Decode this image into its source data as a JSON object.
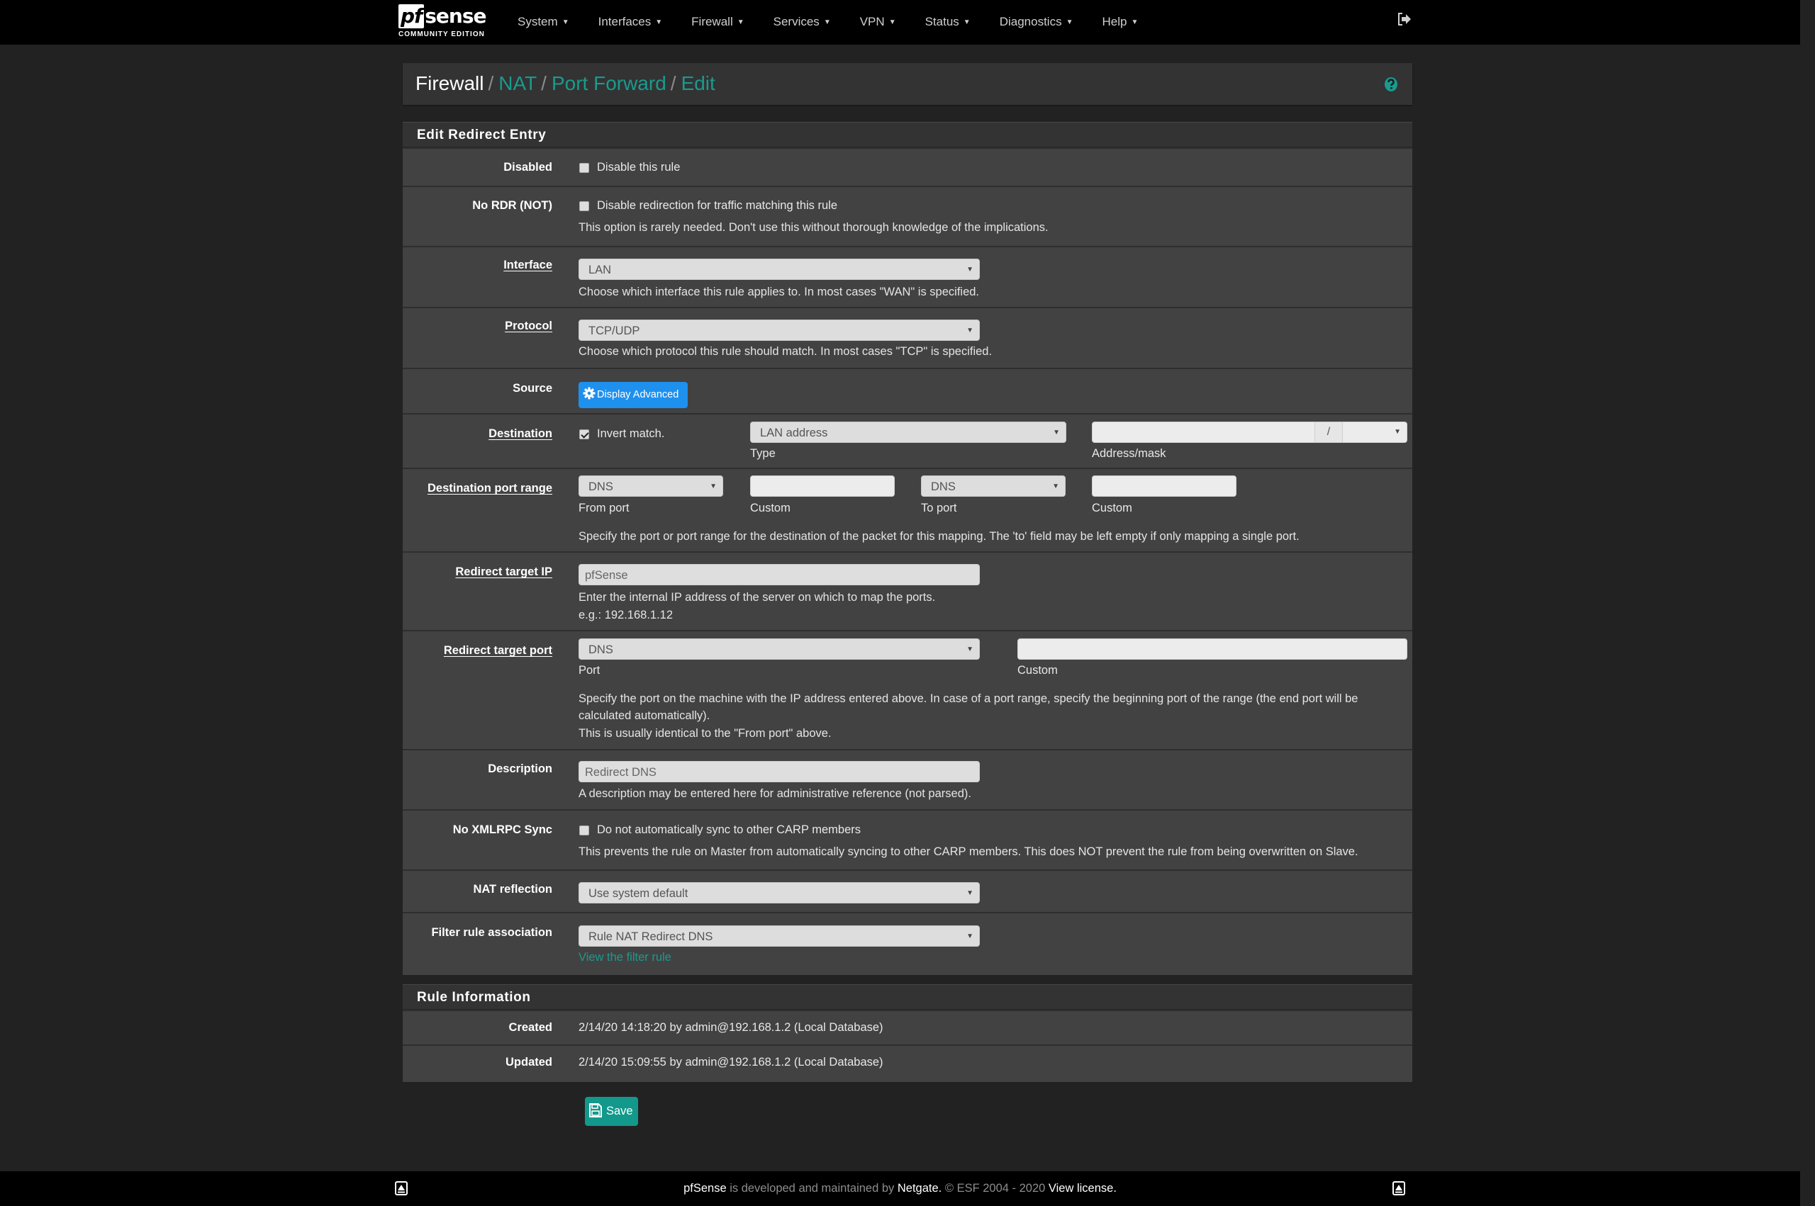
{
  "brand": {
    "logo_text_pf": "pf",
    "logo_text_sense": "sense",
    "edition": "COMMUNITY EDITION"
  },
  "nav": {
    "items": [
      {
        "label": "System"
      },
      {
        "label": "Interfaces"
      },
      {
        "label": "Firewall"
      },
      {
        "label": "Services"
      },
      {
        "label": "VPN"
      },
      {
        "label": "Status"
      },
      {
        "label": "Diagnostics"
      },
      {
        "label": "Help"
      }
    ],
    "caret": "▼",
    "logout_icon": "logout-icon"
  },
  "breadcrumb": {
    "items": [
      "Firewall",
      "NAT",
      "Port Forward",
      "Edit"
    ],
    "separator": "/",
    "help_icon": "help-icon"
  },
  "edit_panel": {
    "title": "Edit Redirect Entry",
    "disabled": {
      "label": "Disabled",
      "checkbox_label": "Disable this rule",
      "checked": false
    },
    "nordr": {
      "label": "No RDR (NOT)",
      "checkbox_label": "Disable redirection for traffic matching this rule",
      "checked": false,
      "hint": "This option is rarely needed. Don't use this without thorough knowledge of the implications."
    },
    "interface": {
      "label": "Interface",
      "value": "LAN",
      "hint": "Choose which interface this rule applies to. In most cases \"WAN\" is specified."
    },
    "protocol": {
      "label": "Protocol",
      "value": "TCP/UDP",
      "hint": "Choose which protocol this rule should match. In most cases \"TCP\" is specified."
    },
    "source": {
      "label": "Source",
      "button_label": "Display Advanced",
      "button_icon": "gear-icon"
    },
    "destination": {
      "label": "Destination",
      "invert_label": "Invert match.",
      "invert_checked": true,
      "type_value": "LAN address",
      "type_caption": "Type",
      "address_value": "",
      "mask_separator": "/",
      "mask_value": "",
      "address_caption": "Address/mask"
    },
    "dest_port_range": {
      "label": "Destination port range",
      "from_port": "DNS",
      "from_caption": "From port",
      "from_custom": "",
      "from_custom_caption": "Custom",
      "to_port": "DNS",
      "to_caption": "To port",
      "to_custom": "",
      "to_custom_caption": "Custom",
      "hint": "Specify the port or port range for the destination of the packet for this mapping. The 'to' field may be left empty if only mapping a single port."
    },
    "redirect_ip": {
      "label": "Redirect target IP",
      "value": "pfSense",
      "hint1": "Enter the internal IP address of the server on which to map the ports.",
      "hint2": "e.g.: 192.168.1.12"
    },
    "redirect_port": {
      "label": "Redirect target port",
      "port_value": "DNS",
      "port_caption": "Port",
      "custom_value": "",
      "custom_caption": "Custom",
      "hint1": "Specify the port on the machine with the IP address entered above. In case of a port range, specify the beginning port of the range (the end port will be",
      "hint2": "calculated automatically).",
      "hint3": "This is usually identical to the \"From port\" above."
    },
    "description": {
      "label": "Description",
      "value": "Redirect DNS",
      "hint": "A description may be entered here for administrative reference (not parsed)."
    },
    "noxmlrpc": {
      "label": "No XMLRPC Sync",
      "checkbox_label": "Do not automatically sync to other CARP members",
      "checked": false,
      "hint": "This prevents the rule on Master from automatically syncing to other CARP members. This does NOT prevent the rule from being overwritten on Slave."
    },
    "nat_reflection": {
      "label": "NAT reflection",
      "value": "Use system default"
    },
    "filter_assoc": {
      "label": "Filter rule association",
      "value": "Rule NAT Redirect DNS",
      "link": "View the filter rule"
    }
  },
  "rule_info": {
    "title": "Rule Information",
    "created": {
      "label": "Created",
      "value": "2/14/20 14:18:20 by admin@192.168.1.2 (Local Database)"
    },
    "updated": {
      "label": "Updated",
      "value": "2/14/20 15:09:55 by admin@192.168.1.2 (Local Database)"
    }
  },
  "save_button": {
    "label": "Save",
    "icon": "save-icon"
  },
  "footer": {
    "brand": "pfSense",
    "text1": " is developed and maintained by ",
    "company": "Netgate.",
    "text2": " © ESF 2004 - 2020 ",
    "license": "View license."
  },
  "colors": {
    "accent": "#199b8e",
    "primary_button": "#1e90ee",
    "success_button": "#12998b",
    "navbar": "#000000",
    "background": "#222222",
    "panel": "#424242"
  }
}
